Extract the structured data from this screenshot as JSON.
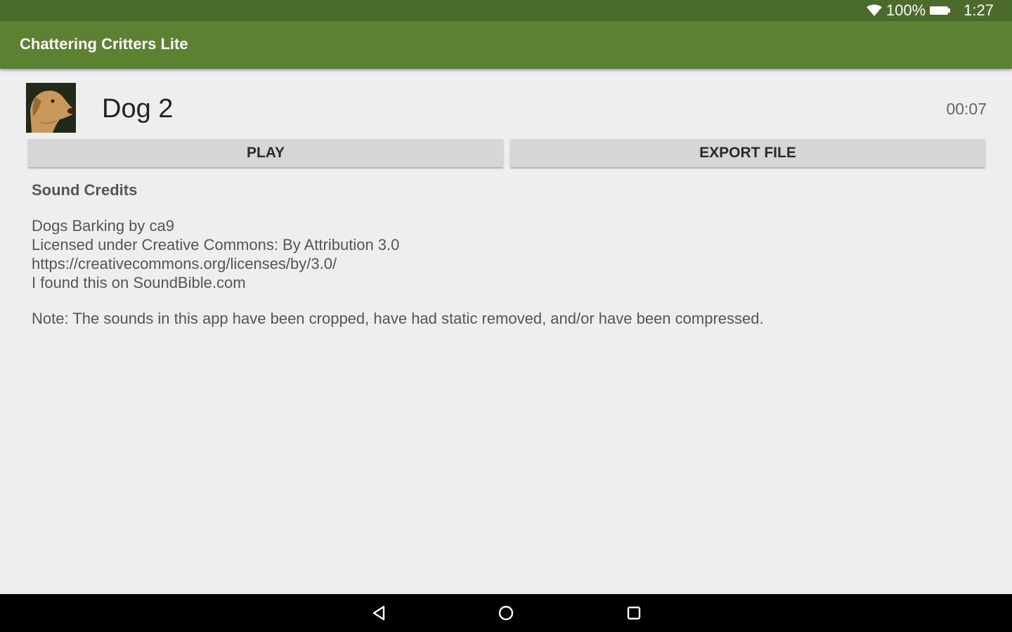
{
  "status_bar": {
    "battery": "100%",
    "time": "1:27",
    "icons": [
      "wifi-icon",
      "battery-icon"
    ]
  },
  "app_bar": {
    "title": "Chattering Critters Lite"
  },
  "sound": {
    "title": "Dog 2",
    "duration": "00:07",
    "thumbnail": "dog-image"
  },
  "buttons": {
    "play": "PLAY",
    "export": "EXPORT FILE"
  },
  "credits": {
    "title": "Sound Credits",
    "lines": [
      "Dogs Barking by ca9",
      "Licensed under Creative Commons: By Attribution 3.0",
      "https://creativecommons.org/licenses/by/3.0/",
      "I found this on SoundBible.com"
    ],
    "note": "Note: The sounds in this app have been cropped, have had static removed, and/or have been compressed."
  },
  "nav_bar": {
    "icons": [
      "back-icon",
      "home-icon",
      "recents-icon"
    ]
  },
  "colors": {
    "status_bar": "#4a6b29",
    "app_bar": "#5b8131",
    "background": "#eeeeee",
    "button": "#d6d6d6"
  }
}
